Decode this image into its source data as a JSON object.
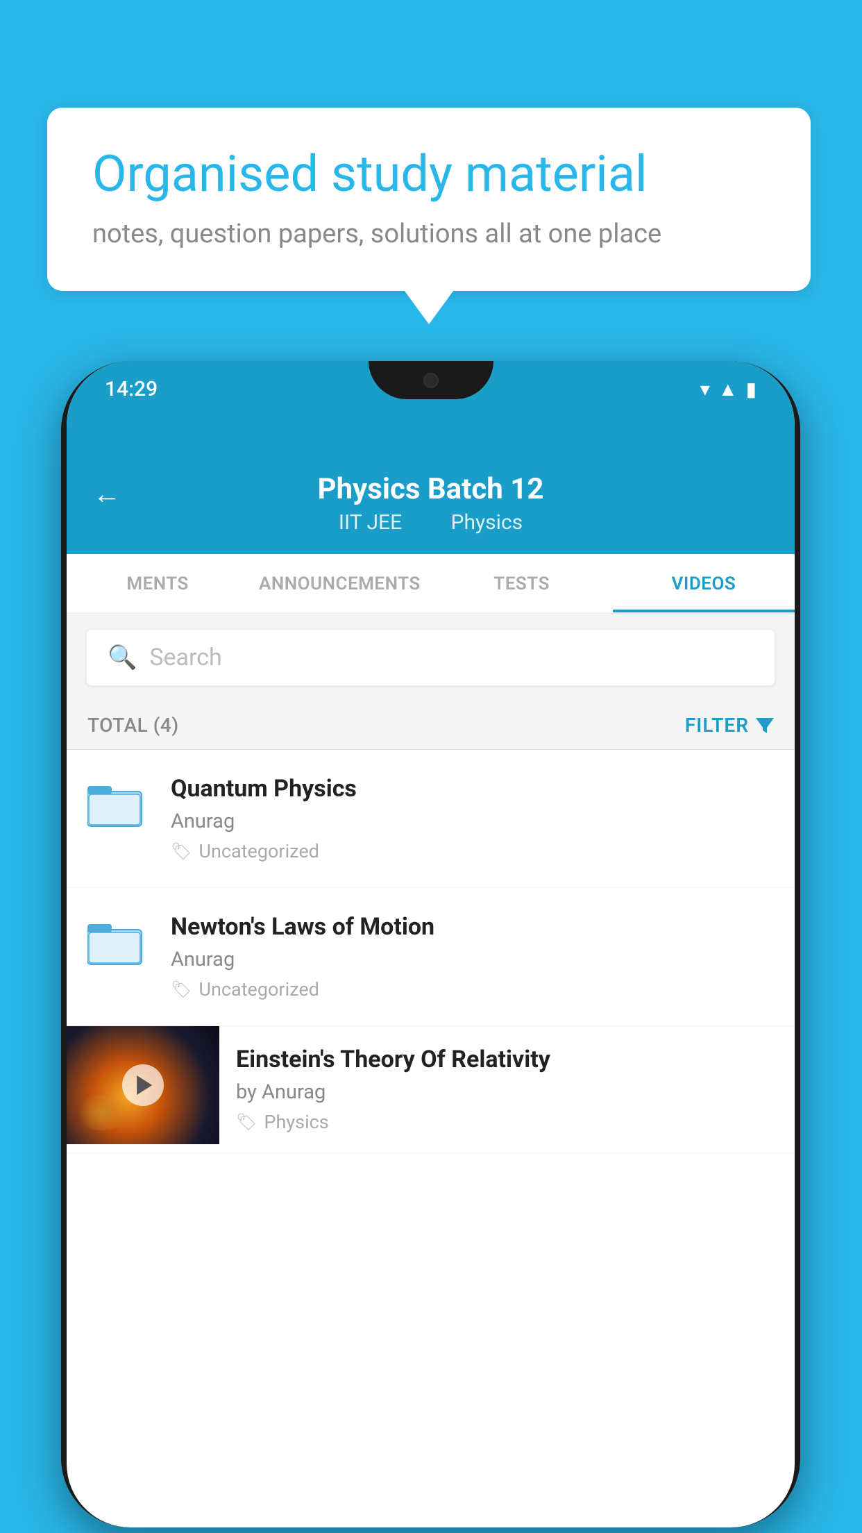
{
  "background_color": "#29b6e8",
  "bubble": {
    "title": "Organised study material",
    "subtitle": "notes, question papers, solutions all at one place"
  },
  "phone": {
    "status_bar": {
      "time": "14:29",
      "wifi_icon": "▾",
      "signal_icon": "▲",
      "battery_icon": "▮"
    },
    "header": {
      "back_label": "←",
      "title": "Physics Batch 12",
      "subtitle1": "IIT JEE",
      "subtitle2": "Physics"
    },
    "tabs": [
      {
        "label": "MENTS",
        "active": false
      },
      {
        "label": "ANNOUNCEMENTS",
        "active": false
      },
      {
        "label": "TESTS",
        "active": false
      },
      {
        "label": "VIDEOS",
        "active": true
      }
    ],
    "search": {
      "placeholder": "Search"
    },
    "filter_bar": {
      "total_label": "TOTAL (4)",
      "filter_label": "FILTER"
    },
    "videos": [
      {
        "title": "Quantum Physics",
        "author": "Anurag",
        "tag": "Uncategorized",
        "has_thumbnail": false
      },
      {
        "title": "Newton's Laws of Motion",
        "author": "Anurag",
        "tag": "Uncategorized",
        "has_thumbnail": false
      },
      {
        "title": "Einstein's Theory Of Relativity",
        "author": "by Anurag",
        "tag": "Physics",
        "has_thumbnail": true
      }
    ]
  }
}
